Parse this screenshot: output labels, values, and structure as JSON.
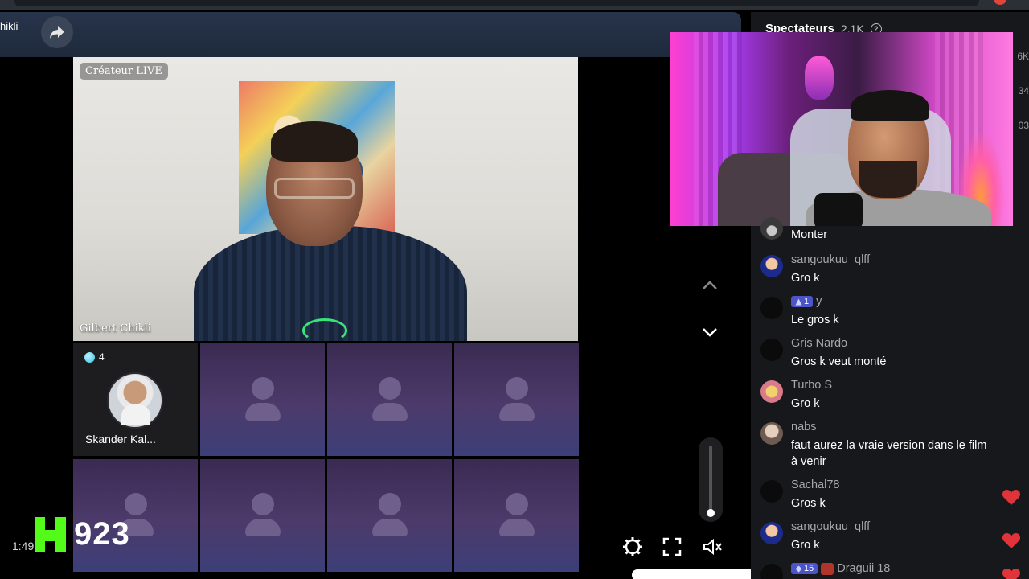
{
  "header": {
    "streamer_name": "hikli"
  },
  "host_video": {
    "tag": "Créateur LIVE",
    "name": "Gilbert Chikli"
  },
  "guests": [
    {
      "name": "Skander Kal...",
      "badge_count": "4"
    }
  ],
  "overlay": {
    "kick_count": "923",
    "time": "1:49"
  },
  "volume": {
    "level": 0.05
  },
  "panel": {
    "title": "Spectateurs",
    "count": "2.1K",
    "edge_numbers": [
      "6K",
      "34",
      "03"
    ]
  },
  "chat": {
    "messages": [
      {
        "user": "",
        "text": "Monter",
        "avatar": "monter"
      },
      {
        "user": "sangoukuu_qlff",
        "text": "Gro k",
        "avatar": "goku"
      },
      {
        "user": "y",
        "text": "Le gros k",
        "avatar": "none",
        "badge": "1"
      },
      {
        "user": "Gris Nardo",
        "text": "Gros k veut monté",
        "avatar": "none"
      },
      {
        "user": "Turbo S",
        "text": "Gro k",
        "avatar": "turbo"
      },
      {
        "user": "nabs",
        "text": "faut aurez la vraie version dans le film à venir",
        "avatar": "nabs"
      },
      {
        "user": "Sachal78",
        "text": "Gros k",
        "avatar": "none",
        "liked": true
      },
      {
        "user": "sangoukuu_qlff",
        "text": "Gro k",
        "avatar": "goku",
        "liked": true
      },
      {
        "user": "Draguii 18",
        "text": "",
        "avatar": "none",
        "badge": "15",
        "liked": true
      }
    ]
  },
  "colors": {
    "kick_green": "#53fc18",
    "like_red": "#e0343a",
    "mic_green": "#38e37a"
  }
}
